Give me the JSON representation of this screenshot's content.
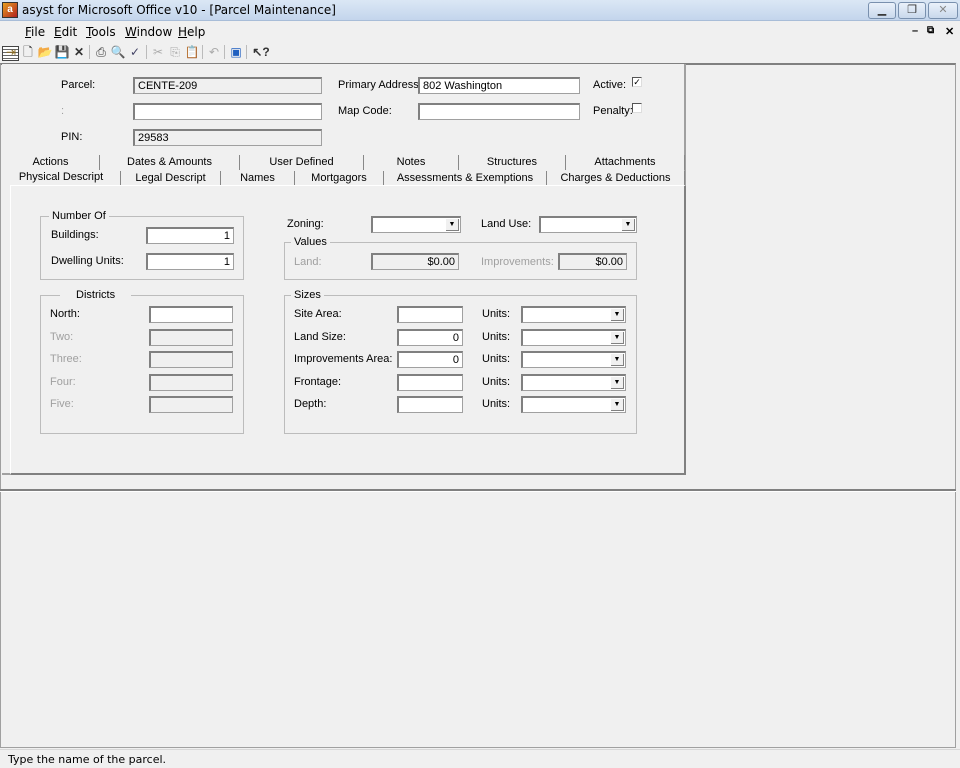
{
  "window": {
    "title": "asyst for Microsoft Office v10 - [Parcel Maintenance]",
    "app_icon": "asyst-app-icon",
    "controls": [
      "minimize",
      "restore",
      "close"
    ]
  },
  "menu": {
    "items": [
      {
        "label": "File",
        "accel": "F",
        "rest": "ile"
      },
      {
        "label": "Edit",
        "accel": "E",
        "rest": "dit"
      },
      {
        "label": "Tools",
        "accel": "T",
        "rest": "ools"
      },
      {
        "label": "Window",
        "accel": "W",
        "rest": "indow"
      },
      {
        "label": "Help",
        "accel": "H",
        "rest": "elp"
      }
    ],
    "mdi_controls": {
      "minimize": "–",
      "restore": "🗗",
      "close": "✕"
    }
  },
  "toolbar": {
    "icons": [
      "exit-icon",
      "new-icon",
      "open-icon",
      "save-icon",
      "delete-icon",
      "print-icon",
      "print-preview-icon",
      "spell-check-icon",
      "cut-icon",
      "copy-icon",
      "paste-icon",
      "undo-icon",
      "report-icon",
      "help-pointer-icon"
    ]
  },
  "header": {
    "parcel_label": "Parcel:",
    "parcel_value": "CENTE-209",
    "colon_label": ":",
    "colon_value": "",
    "pin_label": "PIN:",
    "pin_value": "29583",
    "primary_address_label": "Primary Address",
    "primary_address_value": "802 Washington",
    "map_code_label": "Map Code:",
    "map_code_value": "",
    "active_label": "Active:",
    "active_checked": true,
    "penalty_label": "Penalty:",
    "penalty_checked": false
  },
  "tabs": {
    "row1": [
      "Actions",
      "Dates & Amounts",
      "User Defined",
      "Notes",
      "Structures",
      "Attachments"
    ],
    "row2": [
      "Physical Descript",
      "Legal Descript",
      "Names",
      "Mortgagors",
      "Assessments & Exemptions",
      "Charges & Deductions"
    ],
    "active": "Physical Descript"
  },
  "physical": {
    "number_of": {
      "title": "Number Of",
      "buildings_label": "Buildings:",
      "buildings_value": "1",
      "dwelling_label": "Dwelling Units:",
      "dwelling_value": "1"
    },
    "districts": {
      "title": "Districts",
      "items": [
        {
          "label": "North:",
          "value": "",
          "enabled": true
        },
        {
          "label": "Two:",
          "value": "",
          "enabled": false
        },
        {
          "label": "Three:",
          "value": "",
          "enabled": false
        },
        {
          "label": "Four:",
          "value": "",
          "enabled": false
        },
        {
          "label": "Five:",
          "value": "",
          "enabled": false
        }
      ]
    },
    "zoning_label": "Zoning:",
    "zoning_value": "",
    "land_use_label": "Land Use:",
    "land_use_value": "",
    "values": {
      "title": "Values",
      "land_label": "Land:",
      "land_value": "$0.00",
      "improvements_label": "Improvements:",
      "improvements_value": "$0.00"
    },
    "sizes": {
      "title": "Sizes",
      "units_label": "Units:",
      "rows": [
        {
          "label": "Site Area:",
          "value": "",
          "units": ""
        },
        {
          "label": "Land Size:",
          "value": "0",
          "units": ""
        },
        {
          "label": "Improvements Area:",
          "value": "0",
          "units": ""
        },
        {
          "label": "Frontage:",
          "value": "",
          "units": ""
        },
        {
          "label": "Depth:",
          "value": "",
          "units": ""
        }
      ]
    }
  },
  "status": {
    "text": "Type the name of the parcel."
  }
}
